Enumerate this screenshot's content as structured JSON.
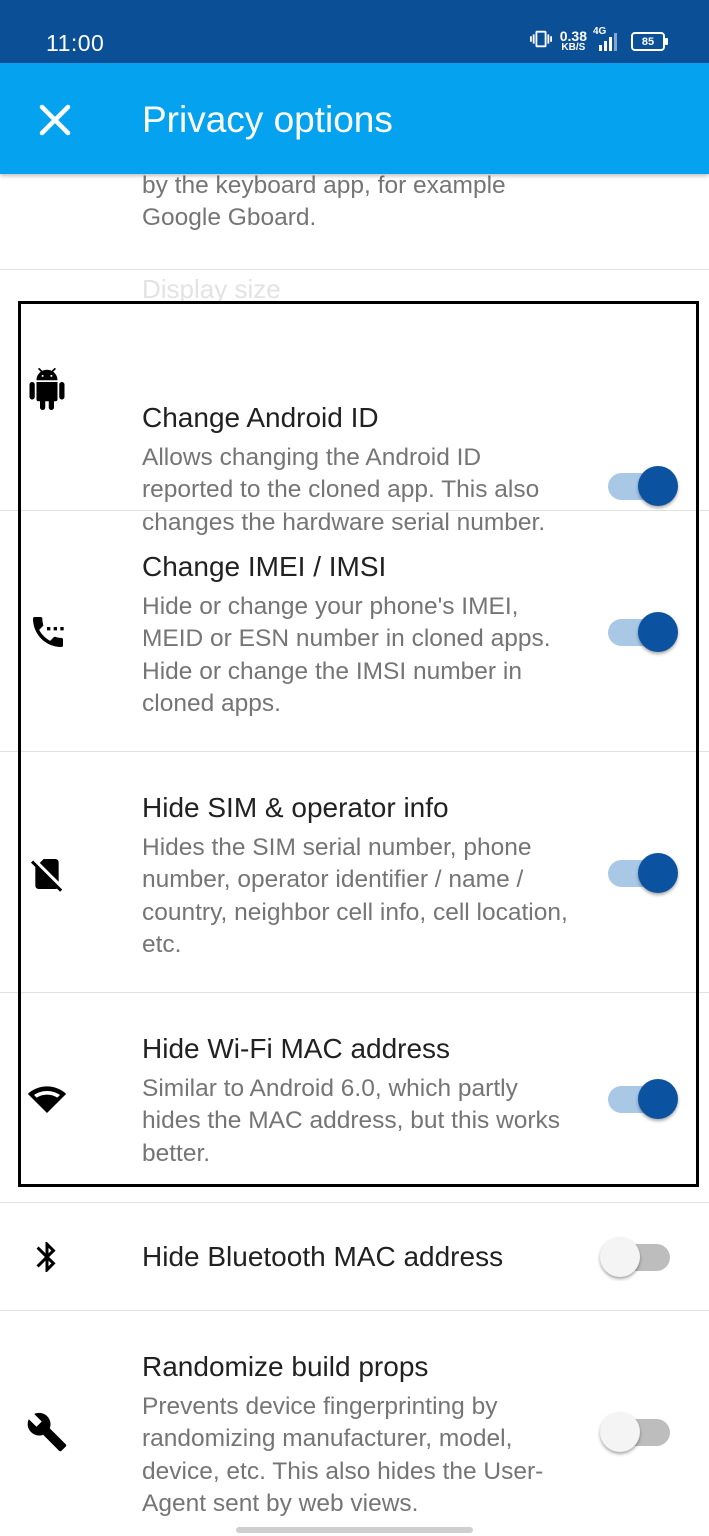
{
  "status_bar": {
    "time": "11:00",
    "net_speed_value": "0.38",
    "net_speed_unit": "KB/S",
    "network": "4G",
    "battery": "85"
  },
  "app_bar": {
    "close_icon": "close-icon",
    "title": "Privacy options",
    "background": "#05a2ef"
  },
  "top_fragment": {
    "desc": "by the keyboard app, for example Google Gboard."
  },
  "ghost_text": {
    "display": "Display size"
  },
  "settings": [
    {
      "icon": "android-icon",
      "title": "Change Android ID",
      "desc": "Allows changing the Android ID reported to the cloned app. This also changes the hardware serial number.",
      "enabled": true
    },
    {
      "icon": "phone-dots-icon",
      "title": "Change IMEI / IMSI",
      "desc": "Hide or change your phone's IMEI, MEID or ESN number in cloned apps. Hide or change the IMSI number in cloned apps.",
      "enabled": true
    },
    {
      "icon": "no-sim-icon",
      "title": "Hide SIM & operator info",
      "desc": "Hides the SIM serial number, phone number, operator identifier / name / country, neighbor cell info, cell location, etc.",
      "enabled": true
    },
    {
      "icon": "wifi-icon",
      "title": "Hide Wi-Fi MAC address",
      "desc": "Similar to Android 6.0, which partly hides the MAC address, but this works better.",
      "enabled": true
    },
    {
      "icon": "bluetooth-icon",
      "title": "Hide Bluetooth MAC address",
      "desc": "",
      "enabled": false
    },
    {
      "icon": "wrench-icon",
      "title": "Randomize build props",
      "desc": "Prevents device fingerprinting by randomizing manufacturer, model, device, etc. This also hides the User-Agent sent by web views.",
      "enabled": false
    }
  ],
  "colors": {
    "toggle_on_thumb": "#0b52a1",
    "toggle_on_track": "#a8c8e6",
    "highlight_border": "#000000"
  }
}
